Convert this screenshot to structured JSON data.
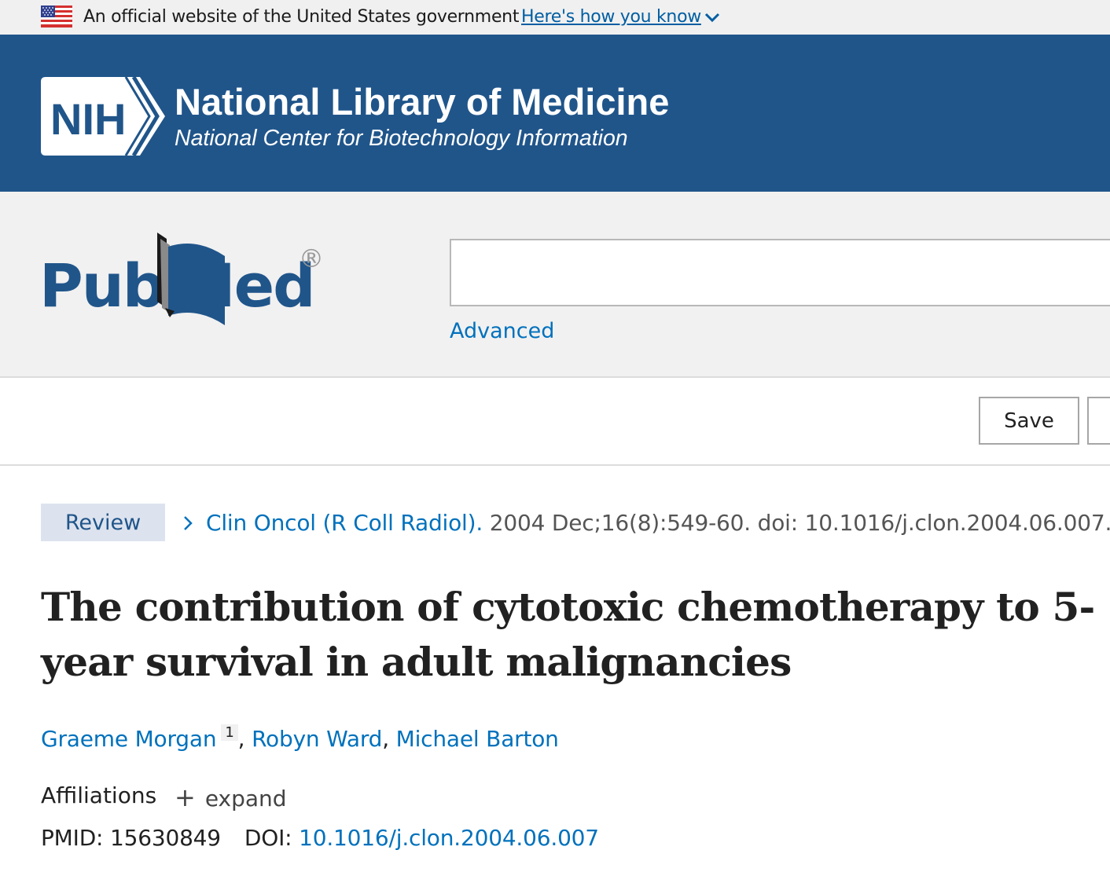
{
  "gov_banner": {
    "text": "An official website of the United States government",
    "link_label": "Here's how you know",
    "flag_icon": "us-flag-icon",
    "chevron_icon": "chevron-down-icon"
  },
  "nih_header": {
    "logo_text": "NIH",
    "title": "National Library of Medicine",
    "subtitle": "National Center for Biotechnology Information",
    "background_color": "#20558a"
  },
  "search": {
    "logo_text_pub": "Pub",
    "logo_text_med": "Med",
    "logo_registered": "®",
    "query_value": "",
    "advanced_label": "Advanced"
  },
  "actions": {
    "save_label": "Save"
  },
  "article": {
    "type_badge": "Review",
    "journal": "Clin Oncol (R Coll Radiol).",
    "citation_meta": "2004 Dec;16(8):549-60. doi: 10.1016/j.clon.2004.06.007.",
    "title": "The contribution of cytotoxic chemotherapy to 5-year survival in adult malignancies",
    "authors": [
      {
        "name": "Graeme Morgan",
        "affiliation": "1"
      },
      {
        "name": "Robyn Ward"
      },
      {
        "name": "Michael Barton"
      }
    ],
    "affiliations_label": "Affiliations",
    "expand_label": "expand",
    "pmid_label": "PMID:",
    "pmid": "15630849",
    "doi_label": "DOI:",
    "doi": "10.1016/j.clon.2004.06.007"
  },
  "colors": {
    "link": "#0071bc",
    "badge_bg": "#dde3ee",
    "pubmed_blue": "#20558a"
  }
}
